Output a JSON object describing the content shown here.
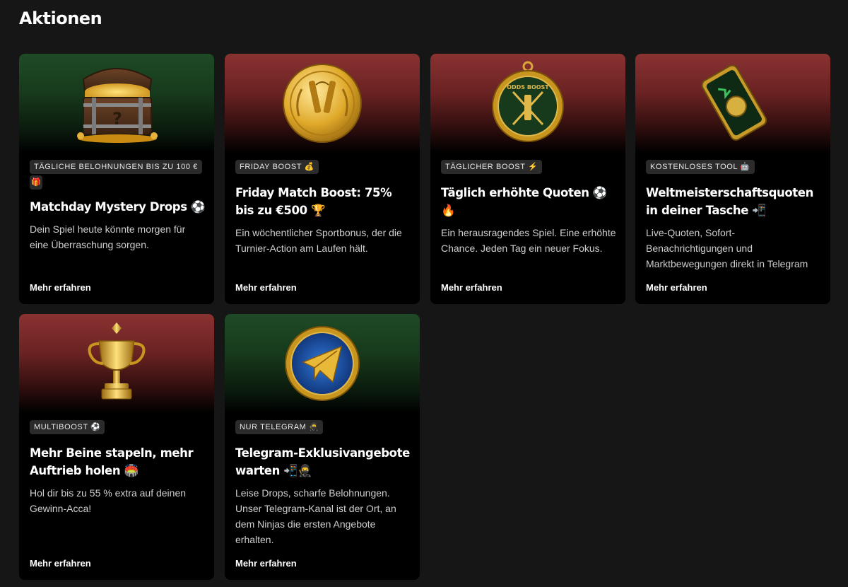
{
  "page": {
    "title": "Aktionen"
  },
  "cards": [
    {
      "badge": "TÄGLICHE BELOHNUNGEN BIS ZU 100 €",
      "badge_emoji": "🎁",
      "title": "Matchday Mystery Drops ⚽",
      "description": "Dein Spiel heute könnte morgen für eine Überraschung sorgen.",
      "link": "Mehr erfahren",
      "image": "treasure-chest-icon",
      "theme": "green"
    },
    {
      "badge": "FRIDAY BOOST 💰",
      "title": "Friday Match Boost: 75% bis zu €500 🏆",
      "description": "Ein wöchentlicher Sportbonus, der die Turnier-Action am Laufen hält.",
      "link": "Mehr erfahren",
      "image": "gold-coin-icon",
      "theme": "red"
    },
    {
      "badge": "TÄGLICHER BOOST ⚡",
      "title": "Täglich erhöhte Quoten ⚽🔥",
      "description": "Ein herausragendes Spiel. Eine erhöhte Chance. Jeden Tag ein neuer Fokus.",
      "link": "Mehr erfahren",
      "image": "odds-boost-medal-icon",
      "medal_text": "ODDS BOOST",
      "theme": "red"
    },
    {
      "badge": "KOSTENLOSES TOOL 🤖",
      "title": "Weltmeisterschaftsquoten in deiner Tasche 📲",
      "description": "Live-Quoten, Sofort-Benachrichtigungen und Marktbewegungen direkt in Telegram",
      "link": "Mehr erfahren",
      "image": "smartphone-icon",
      "theme": "red"
    },
    {
      "badge": "MULTIBOOST ⚽",
      "title": "Mehr Beine stapeln, mehr Auftrieb holen 🏟️",
      "description": "Hol dir bis zu 55 % extra auf deinen Gewinn-Acca!",
      "link": "Mehr erfahren",
      "image": "trophy-icon",
      "theme": "red"
    },
    {
      "badge": "NUR TELEGRAM 🥷",
      "title": "Telegram-Exklusivangebote warten 📲🥷",
      "description": "Leise Drops, scharfe Belohnungen. Unser Telegram-Kanal ist der Ort, an dem Ninjas die ersten Angebote erhalten.",
      "link": "Mehr erfahren",
      "image": "telegram-plane-icon",
      "theme": "green"
    }
  ]
}
